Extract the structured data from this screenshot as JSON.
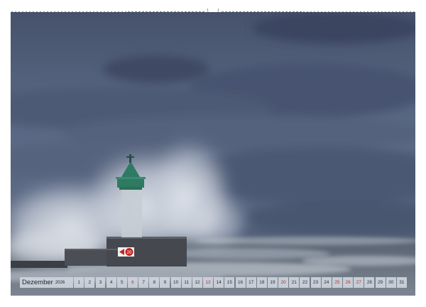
{
  "calendar": {
    "month": "Dezember",
    "year": "2026",
    "days": [
      {
        "n": "1",
        "red": false
      },
      {
        "n": "2",
        "red": false
      },
      {
        "n": "3",
        "red": false
      },
      {
        "n": "4",
        "red": false
      },
      {
        "n": "5",
        "red": false
      },
      {
        "n": "6",
        "red": true
      },
      {
        "n": "7",
        "red": false
      },
      {
        "n": "8",
        "red": false
      },
      {
        "n": "9",
        "red": false
      },
      {
        "n": "10",
        "red": false
      },
      {
        "n": "11",
        "red": false
      },
      {
        "n": "12",
        "red": false
      },
      {
        "n": "13",
        "red": true
      },
      {
        "n": "14",
        "red": false
      },
      {
        "n": "15",
        "red": false
      },
      {
        "n": "16",
        "red": false
      },
      {
        "n": "17",
        "red": false
      },
      {
        "n": "18",
        "red": false
      },
      {
        "n": "19",
        "red": false
      },
      {
        "n": "20",
        "red": true
      },
      {
        "n": "21",
        "red": false
      },
      {
        "n": "22",
        "red": false
      },
      {
        "n": "23",
        "red": false
      },
      {
        "n": "24",
        "red": false
      },
      {
        "n": "25",
        "red": true
      },
      {
        "n": "26",
        "red": true
      },
      {
        "n": "27",
        "red": true
      },
      {
        "n": "28",
        "red": false
      },
      {
        "n": "29",
        "red": false
      },
      {
        "n": "30",
        "red": false
      },
      {
        "n": "31",
        "red": false
      }
    ],
    "red_color": "#c0302e"
  },
  "photo": {
    "sign_text": "20",
    "colors": {
      "sky_top": "#4a5670",
      "sky_mid": "#5c6a86",
      "sea": "#4f5d6e",
      "lighthouse_green": "#2f7a62",
      "spray": "#d9dee6"
    }
  }
}
